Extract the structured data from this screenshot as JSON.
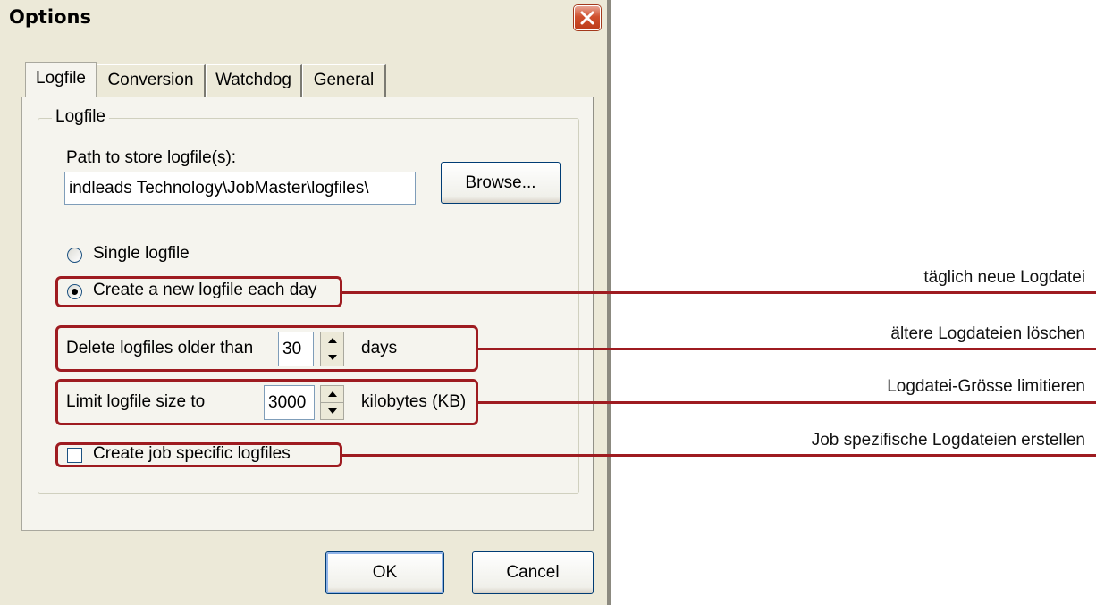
{
  "window": {
    "title": "Options"
  },
  "tabs": [
    {
      "label": "Logfile",
      "active": true
    },
    {
      "label": "Conversion",
      "active": false
    },
    {
      "label": "Watchdog",
      "active": false
    },
    {
      "label": "General",
      "active": false
    }
  ],
  "group": {
    "title": "Logfile",
    "path_label": "Path to store logfile(s):",
    "path_value": "indleads Technology\\JobMaster\\logfiles\\",
    "browse_label": "Browse...",
    "single_label": "Single logfile",
    "single_checked": false,
    "daily_label": "Create a new logfile each day",
    "daily_checked": true,
    "delete_label": "Delete logfiles older than",
    "delete_value": "30",
    "delete_unit": "days",
    "limit_label": "Limit logfile size to",
    "limit_value": "3000",
    "limit_unit": "kilobytes (KB)",
    "job_label": "Create job specific logfiles",
    "job_checked": false
  },
  "footer": {
    "ok_label": "OK",
    "cancel_label": "Cancel"
  },
  "annotations": [
    "täglich neue Logdatei",
    "ältere Logdateien löschen",
    "Logdatei-Grösse limitieren",
    "Job spezifische Logdateien erstellen"
  ],
  "colors": {
    "callout": "#9e1b20",
    "dialog_bg": "#ece9d8",
    "tab_bg": "#f5f4ee",
    "close_red": "#d0502e"
  }
}
